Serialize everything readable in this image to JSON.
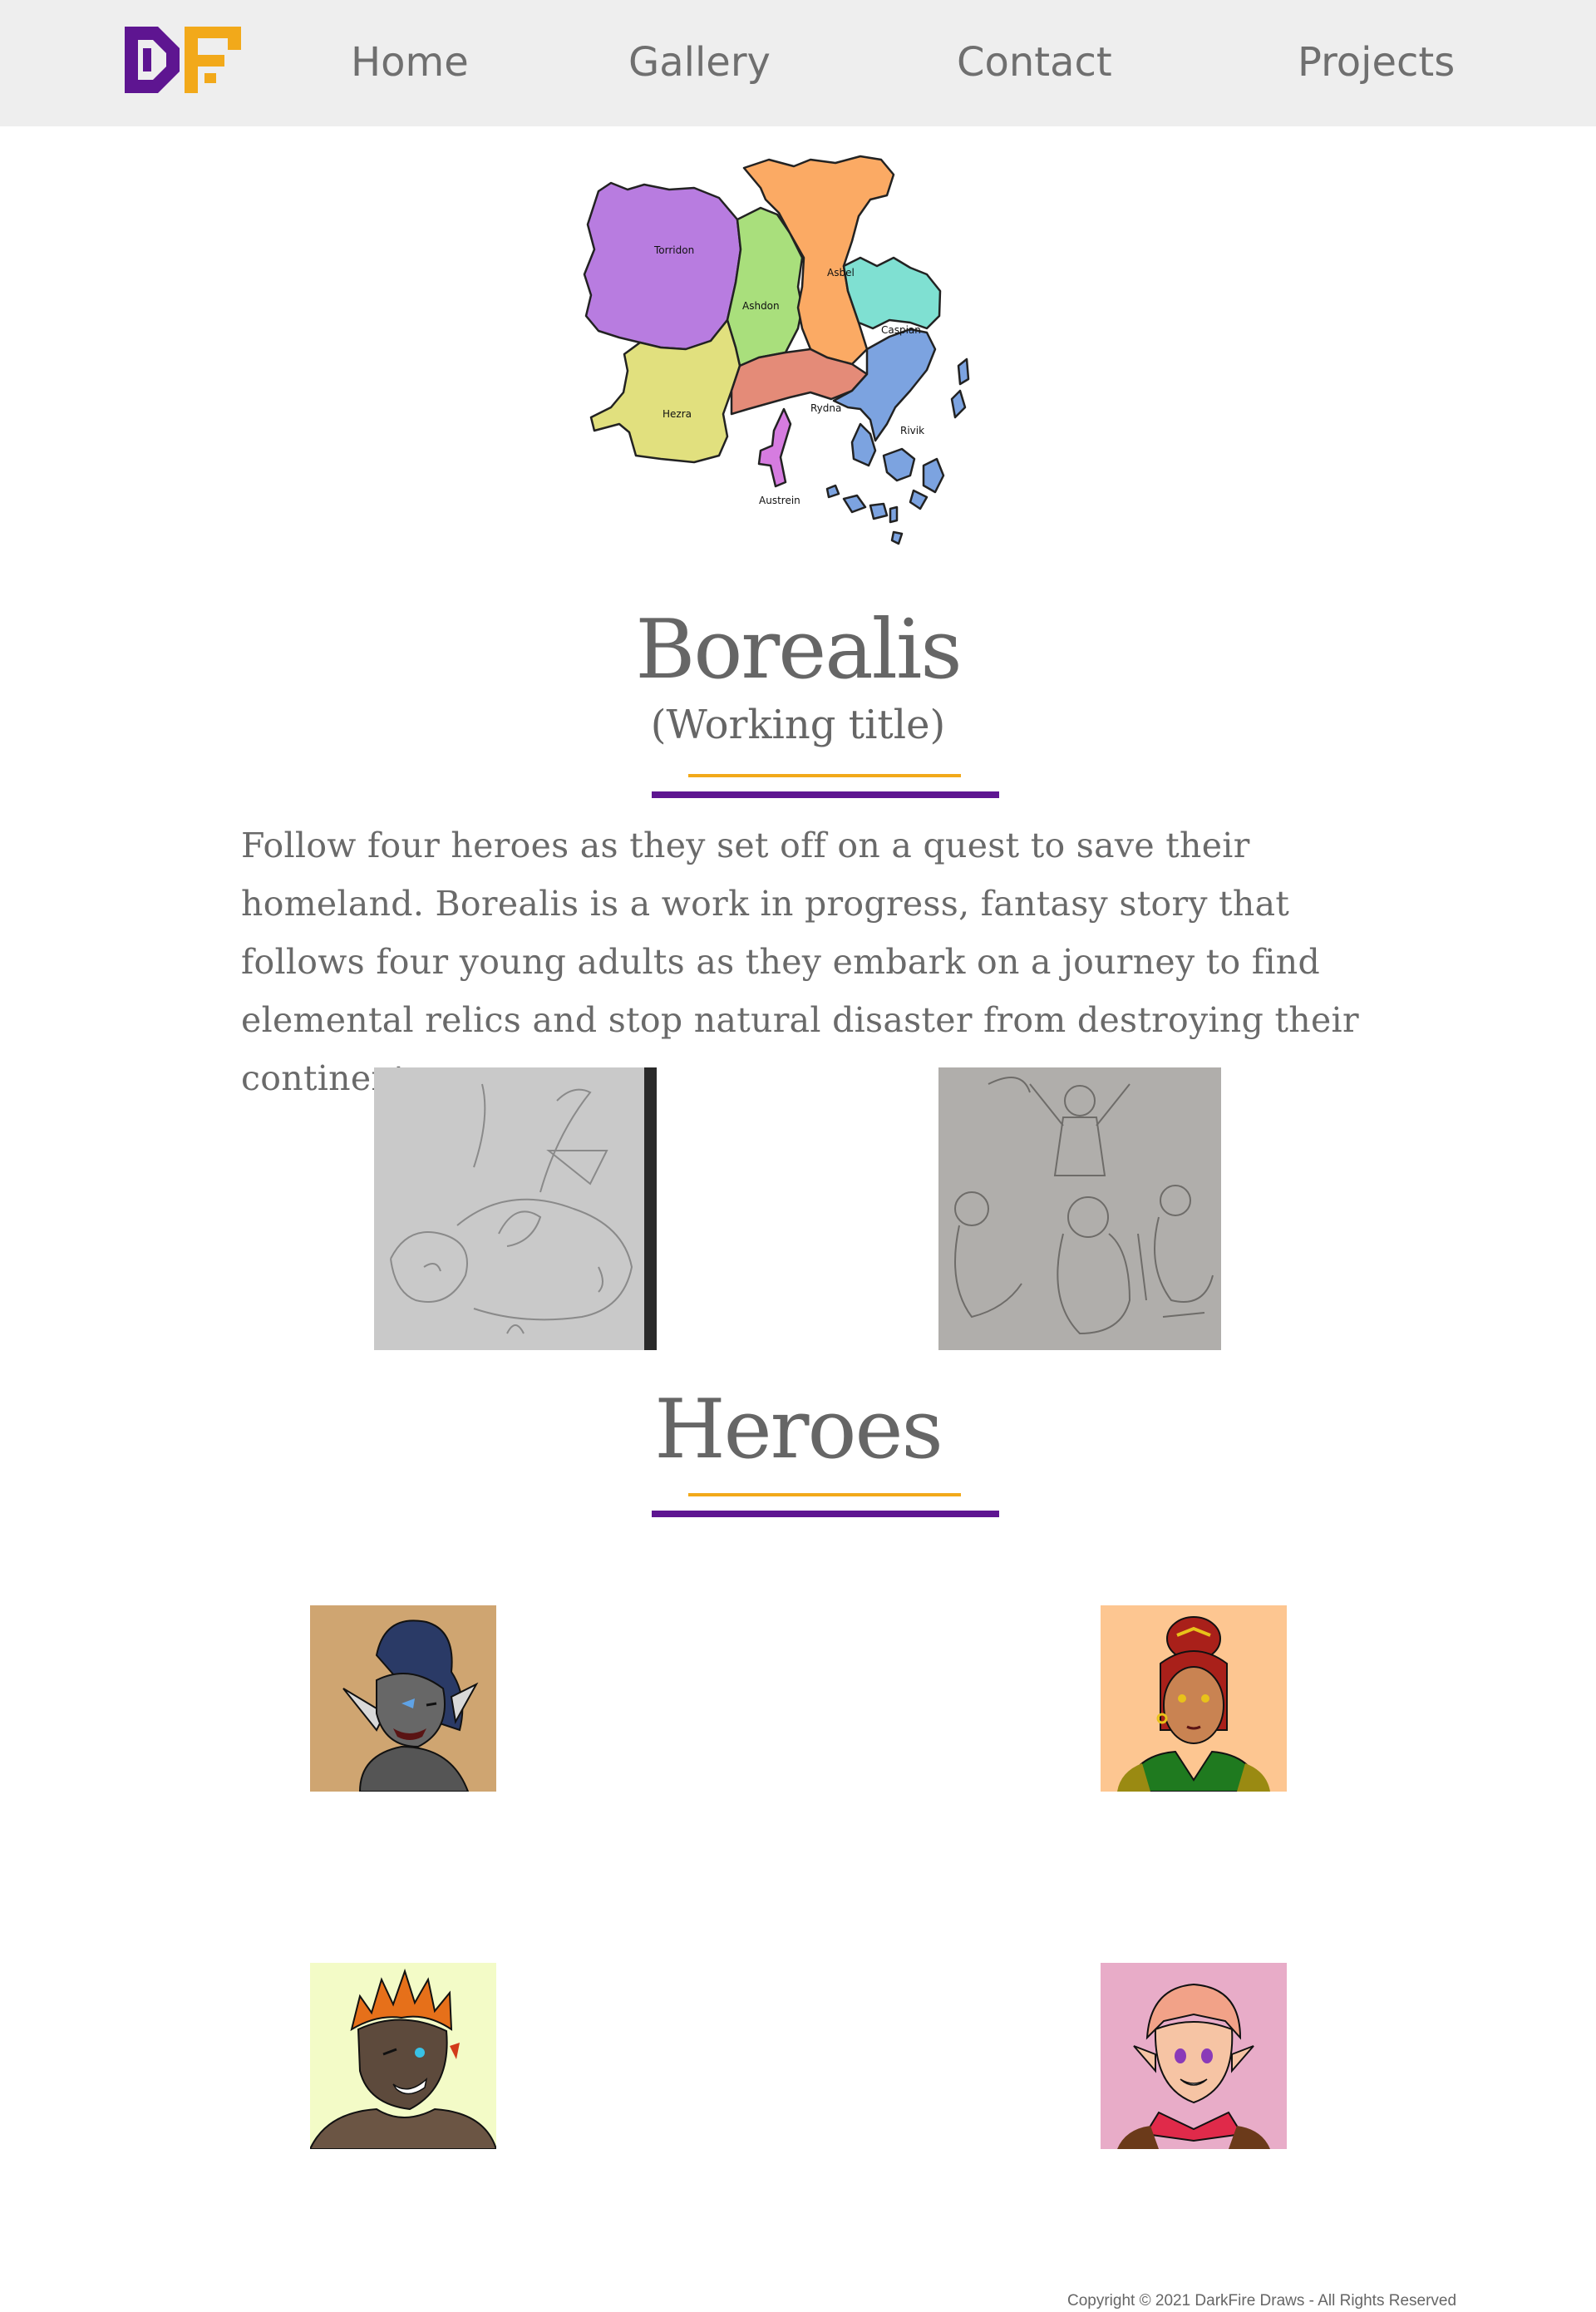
{
  "nav": {
    "logo_text": "DF",
    "items": [
      {
        "label": "Home"
      },
      {
        "label": "Gallery"
      },
      {
        "label": "Contact"
      },
      {
        "label": "Projects"
      }
    ]
  },
  "colors": {
    "nav_bg": "#eeeeee",
    "accent_purple": "#5e1591",
    "accent_gold": "#f2a91a",
    "text_gray": "#666666"
  },
  "map": {
    "regions": [
      {
        "name": "Torridon",
        "color": "#b87ce0"
      },
      {
        "name": "Ashdon",
        "color": "#a9df7c"
      },
      {
        "name": "Asbel",
        "color": "#fbaa64"
      },
      {
        "name": "Caspian",
        "color": "#7fe0d2"
      },
      {
        "name": "Hezra",
        "color": "#e1e07e"
      },
      {
        "name": "Rydna",
        "color": "#e48b78"
      },
      {
        "name": "Rivik",
        "color": "#7ca3e0"
      },
      {
        "name": "Austrein",
        "color": "#d67ce0"
      }
    ]
  },
  "main": {
    "title": "Borealis",
    "subtitle": "(Working title)",
    "description": "Follow four heroes as they set off on a quest to save their homeland. Borealis is a work in progress, fantasy story that follows four young adults as they embark on a journey to find elemental relics and stop natural disaster from destroying their continent."
  },
  "heroes": {
    "title": "Heroes",
    "portraits": [
      {
        "bg": "#cfa571"
      },
      {
        "bg": "#fdc691"
      },
      {
        "bg": "#f3fbc7"
      },
      {
        "bg": "#e8acc8"
      }
    ]
  },
  "footer": {
    "copyright": "Copyright © 2021 DarkFire Draws - All Rights Reserved"
  }
}
